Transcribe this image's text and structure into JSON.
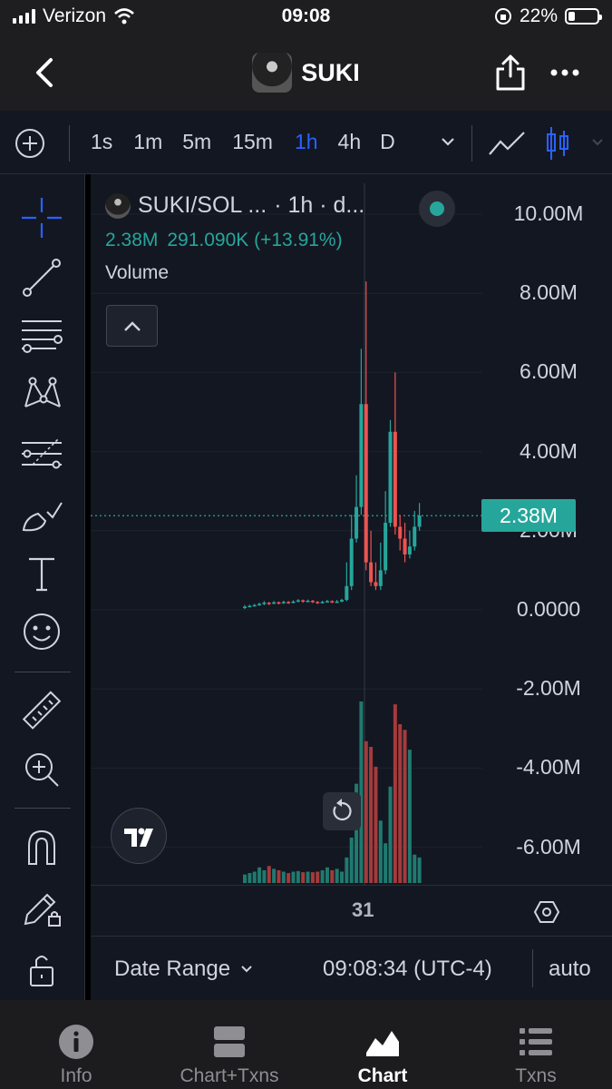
{
  "status_bar": {
    "carrier": "Verizon",
    "time": "09:08",
    "battery": "22%"
  },
  "header": {
    "title": "SUKI"
  },
  "timeframes": {
    "items": [
      "1s",
      "1m",
      "5m",
      "15m",
      "1h",
      "4h",
      "D"
    ],
    "active": "1h"
  },
  "legend": {
    "symbol": "SUKI/SOL ...",
    "interval": "· 1h · d...",
    "price": "2.38M",
    "change": "291.090K (+13.91%)",
    "study": "Volume"
  },
  "price_axis": {
    "labels": [
      "10.00M",
      "8.00M",
      "6.00M",
      "4.00M",
      "2.00M",
      "0.0000",
      "-2.00M",
      "-4.00M",
      "-6.00M"
    ],
    "current_price_tag": "2.38M"
  },
  "time_axis": {
    "tick": "31"
  },
  "bottom_bar": {
    "date_range": "Date Range",
    "clock": "09:08:34 (UTC-4)",
    "scale": "auto"
  },
  "tabs": [
    {
      "label": "Info",
      "icon": "info-icon"
    },
    {
      "label": "Chart+Txns",
      "icon": "split-view-icon"
    },
    {
      "label": "Chart",
      "icon": "chart-icon"
    },
    {
      "label": "Txns",
      "icon": "list-icon"
    }
  ],
  "colors": {
    "up": "#26a69a",
    "down": "#ef5350",
    "accent": "#2962ff",
    "background": "#131722"
  },
  "chart_data": {
    "type": "candlestick",
    "y_range": [
      -7000000,
      10500000
    ],
    "candles": [
      [
        0.05,
        0.08,
        0.02,
        0.12
      ],
      [
        0.08,
        0.1,
        0.06,
        0.13
      ],
      [
        0.1,
        0.12,
        0.08,
        0.15
      ],
      [
        0.12,
        0.15,
        0.1,
        0.18
      ],
      [
        0.15,
        0.18,
        0.12,
        0.22
      ],
      [
        0.18,
        0.16,
        0.12,
        0.2
      ],
      [
        0.16,
        0.19,
        0.14,
        0.22
      ],
      [
        0.19,
        0.17,
        0.14,
        0.21
      ],
      [
        0.17,
        0.2,
        0.15,
        0.23
      ],
      [
        0.2,
        0.18,
        0.15,
        0.22
      ],
      [
        0.18,
        0.21,
        0.16,
        0.24
      ],
      [
        0.21,
        0.24,
        0.19,
        0.27
      ],
      [
        0.24,
        0.21,
        0.18,
        0.26
      ],
      [
        0.21,
        0.23,
        0.19,
        0.26
      ],
      [
        0.23,
        0.2,
        0.17,
        0.25
      ],
      [
        0.2,
        0.18,
        0.15,
        0.22
      ],
      [
        0.18,
        0.2,
        0.16,
        0.23
      ],
      [
        0.2,
        0.22,
        0.18,
        0.25
      ],
      [
        0.22,
        0.19,
        0.17,
        0.24
      ],
      [
        0.19,
        0.21,
        0.17,
        0.25
      ],
      [
        0.21,
        0.25,
        0.19,
        0.28
      ],
      [
        0.25,
        0.6,
        0.22,
        1.2
      ],
      [
        0.6,
        1.8,
        0.5,
        2.4
      ],
      [
        1.8,
        2.6,
        1.7,
        3.4
      ],
      [
        2.6,
        5.2,
        2.4,
        6.6
      ],
      [
        5.2,
        1.2,
        1.0,
        8.3
      ],
      [
        1.2,
        0.7,
        0.6,
        2.0
      ],
      [
        0.7,
        0.6,
        0.5,
        1.2
      ],
      [
        0.6,
        1.0,
        0.5,
        1.7
      ],
      [
        1.0,
        2.2,
        0.9,
        3.0
      ],
      [
        2.2,
        4.5,
        2.1,
        4.8
      ],
      [
        4.5,
        2.1,
        1.9,
        6.0
      ],
      [
        2.1,
        1.8,
        1.5,
        2.4
      ],
      [
        1.8,
        1.4,
        1.2,
        2.2
      ],
      [
        1.4,
        1.6,
        1.3,
        2.0
      ],
      [
        1.6,
        2.1,
        1.5,
        2.5
      ],
      [
        2.1,
        2.38,
        2.0,
        2.7
      ]
    ],
    "volume": [
      0.3,
      0.35,
      0.4,
      0.55,
      0.45,
      0.6,
      0.5,
      0.45,
      0.4,
      0.35,
      0.4,
      0.42,
      0.38,
      0.4,
      0.38,
      0.4,
      0.45,
      0.55,
      0.45,
      0.5,
      0.4,
      0.9,
      1.6,
      3.5,
      6.4,
      5.0,
      4.8,
      4.1,
      2.2,
      1.4,
      3.4,
      6.3,
      5.6,
      5.4,
      4.7,
      1.0,
      0.9
    ],
    "volume_max": 6.4
  }
}
